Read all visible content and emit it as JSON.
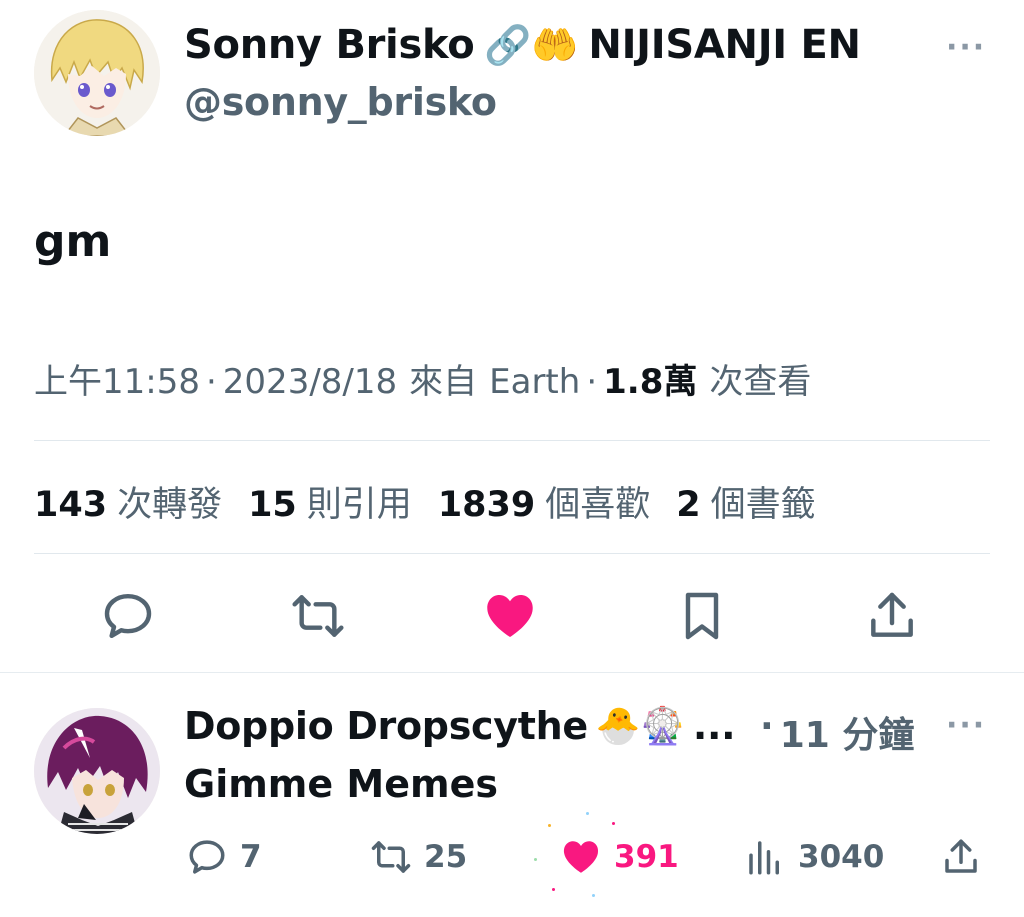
{
  "tweet": {
    "author_name": "Sonny Brisko",
    "author_emojis": "🔗🤲",
    "author_affiliation": "NIJISANJI EN",
    "handle": "@sonny_brisko",
    "text": "gm",
    "time": "上午11:58",
    "date": "2023/8/18",
    "source_prefix": "來自",
    "source": "Earth",
    "views_count": "1.8萬",
    "views_label": "次查看",
    "separator": "·",
    "stats": [
      {
        "count": "143",
        "label": "次轉發"
      },
      {
        "count": "15",
        "label": "則引用"
      },
      {
        "count": "1839",
        "label": "個喜歡"
      },
      {
        "count": "2",
        "label": "個書籤"
      }
    ],
    "more_label": "···"
  },
  "actions": {
    "icons": [
      "reply-icon",
      "retweet-icon",
      "like-icon-filled",
      "bookmark-icon",
      "share-icon"
    ]
  },
  "reply": {
    "author_name": "Doppio Dropscythe",
    "author_emojis": "🐣🎡",
    "ellipsis": "...",
    "separator": "·",
    "time": "11 分鐘",
    "text": "Gimme Memes",
    "more_label": "···",
    "replies": "7",
    "retweets": "25",
    "likes": "391",
    "views": "3040"
  },
  "colors": {
    "like": "#f91880",
    "secondary_text": "#536471",
    "primary_text": "#0f1419",
    "divider": "#e1e8ed"
  }
}
